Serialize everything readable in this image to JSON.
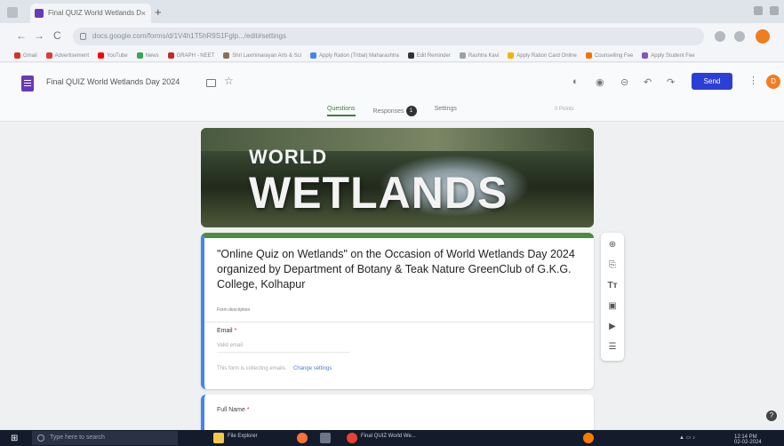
{
  "browser": {
    "tab_title": "Final QUIZ World Wetlands D",
    "tab_close": "×",
    "new_tab": "+",
    "nav_back": "←",
    "nav_forward": "→",
    "nav_reload": "C",
    "url": "docs.google.com/forms/d/1V4h1T5hR9S1Fglp.../edit#settings",
    "bookmarks": [
      "Gmail",
      "Advertisement",
      "YouTube",
      "News",
      "GRAPH - NEET",
      "Shri Laxminarayan Arts & Sci",
      "Apply Ration (Tribal) Maharashtra",
      "Edit Reminder",
      "Rashtra Kavi",
      "Apply Ration Card Online",
      "Counselling Fee",
      "Apply Student Fee"
    ]
  },
  "forms_header": {
    "doc_title": "Final QUIZ World Wetlands Day 2024",
    "send_label": "Send",
    "account_initial": "D",
    "tabs": [
      "Questions",
      "Responses",
      "Settings"
    ],
    "responses_count": "1",
    "points_label": "0 Points"
  },
  "banner": {
    "line1": "WORLD",
    "line2": "WETLANDS"
  },
  "form": {
    "title": "\"Online Quiz on Wetlands\" on the Occasion of World Wetlands Day 2024 organized by Department of Botany & Teak Nature GreenClub of G.K.G. College, Kolhapur",
    "description": "Form description",
    "email_label": "Email",
    "required_mark": "*",
    "email_placeholder": "Valid email",
    "record_note": "This form is collecting emails.",
    "change_settings": "Change settings",
    "next_question_label": "Full Name"
  },
  "toolbar": [
    "⊕",
    "⎘",
    "Tт",
    "▣",
    "▶",
    "☰"
  ],
  "taskbar": {
    "search_placeholder": "Type here to search",
    "items": [
      "File Explorer",
      "Final QUIZ World We..."
    ],
    "time": "12:14 PM",
    "date": "02-02-2024"
  }
}
